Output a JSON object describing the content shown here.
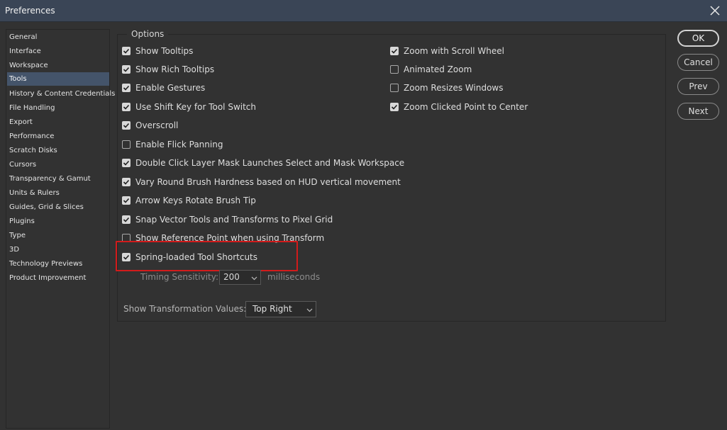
{
  "window": {
    "title": "Preferences"
  },
  "sidebar": {
    "items": [
      {
        "label": "General"
      },
      {
        "label": "Interface"
      },
      {
        "label": "Workspace"
      },
      {
        "label": "Tools",
        "selected": true
      },
      {
        "label": "History & Content Credentials"
      },
      {
        "label": "File Handling"
      },
      {
        "label": "Export"
      },
      {
        "label": "Performance"
      },
      {
        "label": "Scratch Disks"
      },
      {
        "label": "Cursors"
      },
      {
        "label": "Transparency & Gamut"
      },
      {
        "label": "Units & Rulers"
      },
      {
        "label": "Guides, Grid & Slices"
      },
      {
        "label": "Plugins"
      },
      {
        "label": "Type"
      },
      {
        "label": "3D"
      },
      {
        "label": "Technology Previews"
      },
      {
        "label": "Product Improvement"
      }
    ]
  },
  "options": {
    "legend": "Options",
    "left": [
      {
        "label": "Show Tooltips",
        "checked": true
      },
      {
        "label": "Show Rich Tooltips",
        "checked": true
      },
      {
        "label": "Enable Gestures",
        "checked": true
      },
      {
        "label": "Use Shift Key for Tool Switch",
        "checked": true
      },
      {
        "label": "Overscroll",
        "checked": true
      },
      {
        "label": "Enable Flick Panning",
        "checked": false
      },
      {
        "label": "Double Click Layer Mask Launches Select and Mask Workspace",
        "checked": true
      },
      {
        "label": "Vary Round Brush Hardness based on HUD vertical movement",
        "checked": true
      },
      {
        "label": "Arrow Keys Rotate Brush Tip",
        "checked": true
      },
      {
        "label": "Snap Vector Tools and Transforms to Pixel Grid",
        "checked": true
      },
      {
        "label": "Show Reference Point when using Transform",
        "checked": false
      },
      {
        "label": "Spring-loaded Tool Shortcuts",
        "checked": true
      }
    ],
    "right": [
      {
        "label": "Zoom with Scroll Wheel",
        "checked": true
      },
      {
        "label": "Animated Zoom",
        "checked": false
      },
      {
        "label": "Zoom Resizes Windows",
        "checked": false
      },
      {
        "label": "Zoom Clicked Point to Center",
        "checked": true
      }
    ],
    "timing": {
      "label": "Timing Sensitivity:",
      "value": "200",
      "unit": "milliseconds"
    },
    "transformation": {
      "label": "Show Transformation Values:",
      "value": "Top Right"
    }
  },
  "buttons": {
    "ok": "OK",
    "cancel": "Cancel",
    "prev": "Prev",
    "next": "Next"
  },
  "colors": {
    "highlight": "#d21b1b",
    "selected_item": "#44546a",
    "titlebar": "#3a4556"
  }
}
